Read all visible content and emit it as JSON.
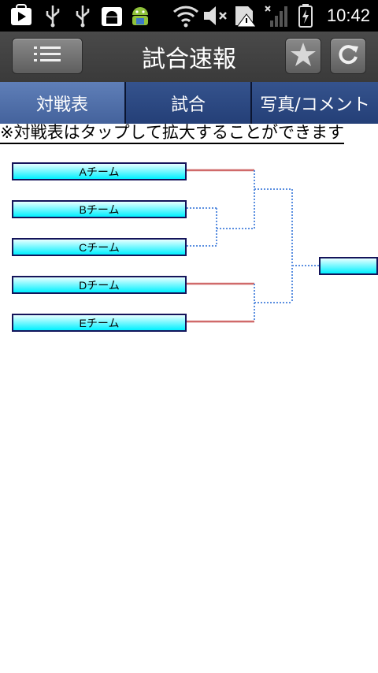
{
  "status_bar": {
    "time": "10:42",
    "icons": [
      "play-store-icon",
      "usb-icon",
      "usb-icon",
      "android-debug-icon",
      "android-mascot-icon",
      "wifi-icon",
      "volume-muted-icon",
      "sd-card-warning-icon",
      "signal-icon",
      "battery-charging-icon"
    ]
  },
  "header": {
    "title": "試合速報",
    "menu_icon": "menu-icon",
    "favorite_icon": "star-icon",
    "refresh_icon": "refresh-icon"
  },
  "tabs": [
    {
      "label": "対戦表",
      "active": true
    },
    {
      "label": "試合",
      "active": false
    },
    {
      "label": "写真/コメント",
      "active": false
    }
  ],
  "notice": "※対戦表はタップして拡大することができます",
  "bracket": {
    "teams": [
      "Aチーム",
      "Bチーム",
      "Cチーム",
      "Dチーム",
      "Eチーム"
    ],
    "colors": {
      "decided_line": "#d06a6a",
      "pending_line": "#5b8fe0",
      "team_fill_top": "#e8ffff",
      "team_fill_bottom": "#00f0ff",
      "team_border": "#14145a"
    }
  }
}
